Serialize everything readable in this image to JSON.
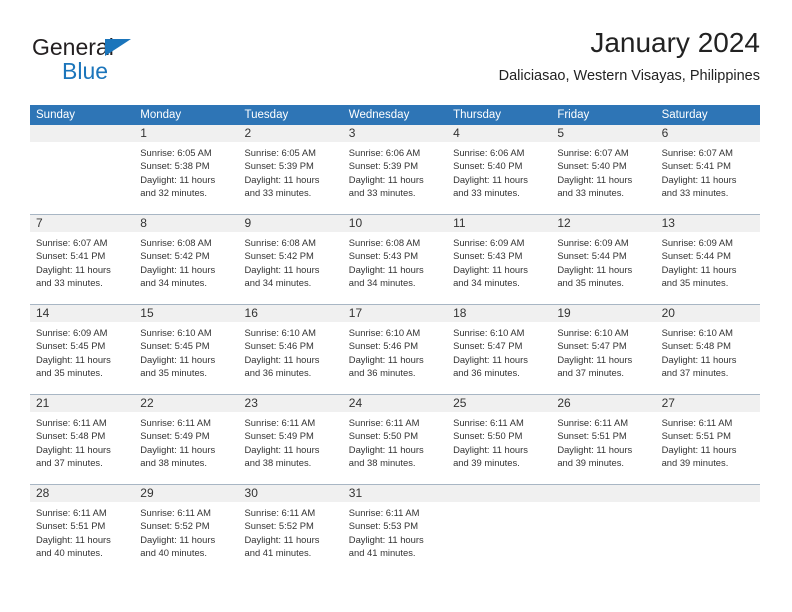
{
  "logo": {
    "word_one": "General",
    "word_two": "Blue",
    "triangle_color": "#1b75bb"
  },
  "header": {
    "title": "January 2024",
    "subtitle": "Daliciasao, Western Visayas, Philippines"
  },
  "colors": {
    "header_blue": "#2e75b6",
    "daynum_band": "#f0f0f0",
    "row_divider": "#a8b6c4",
    "text": "#333333"
  },
  "weekday_headers": [
    "Sunday",
    "Monday",
    "Tuesday",
    "Wednesday",
    "Thursday",
    "Friday",
    "Saturday"
  ],
  "weeks": [
    [
      {
        "day": "",
        "empty": true,
        "sunrise": "",
        "sunset": "",
        "daylight_a": "",
        "daylight_b": ""
      },
      {
        "day": "1",
        "sunrise": "Sunrise: 6:05 AM",
        "sunset": "Sunset: 5:38 PM",
        "daylight_a": "Daylight: 11 hours",
        "daylight_b": "and 32 minutes."
      },
      {
        "day": "2",
        "sunrise": "Sunrise: 6:05 AM",
        "sunset": "Sunset: 5:39 PM",
        "daylight_a": "Daylight: 11 hours",
        "daylight_b": "and 33 minutes."
      },
      {
        "day": "3",
        "sunrise": "Sunrise: 6:06 AM",
        "sunset": "Sunset: 5:39 PM",
        "daylight_a": "Daylight: 11 hours",
        "daylight_b": "and 33 minutes."
      },
      {
        "day": "4",
        "sunrise": "Sunrise: 6:06 AM",
        "sunset": "Sunset: 5:40 PM",
        "daylight_a": "Daylight: 11 hours",
        "daylight_b": "and 33 minutes."
      },
      {
        "day": "5",
        "sunrise": "Sunrise: 6:07 AM",
        "sunset": "Sunset: 5:40 PM",
        "daylight_a": "Daylight: 11 hours",
        "daylight_b": "and 33 minutes."
      },
      {
        "day": "6",
        "sunrise": "Sunrise: 6:07 AM",
        "sunset": "Sunset: 5:41 PM",
        "daylight_a": "Daylight: 11 hours",
        "daylight_b": "and 33 minutes."
      }
    ],
    [
      {
        "day": "7",
        "sunrise": "Sunrise: 6:07 AM",
        "sunset": "Sunset: 5:41 PM",
        "daylight_a": "Daylight: 11 hours",
        "daylight_b": "and 33 minutes."
      },
      {
        "day": "8",
        "sunrise": "Sunrise: 6:08 AM",
        "sunset": "Sunset: 5:42 PM",
        "daylight_a": "Daylight: 11 hours",
        "daylight_b": "and 34 minutes."
      },
      {
        "day": "9",
        "sunrise": "Sunrise: 6:08 AM",
        "sunset": "Sunset: 5:42 PM",
        "daylight_a": "Daylight: 11 hours",
        "daylight_b": "and 34 minutes."
      },
      {
        "day": "10",
        "sunrise": "Sunrise: 6:08 AM",
        "sunset": "Sunset: 5:43 PM",
        "daylight_a": "Daylight: 11 hours",
        "daylight_b": "and 34 minutes."
      },
      {
        "day": "11",
        "sunrise": "Sunrise: 6:09 AM",
        "sunset": "Sunset: 5:43 PM",
        "daylight_a": "Daylight: 11 hours",
        "daylight_b": "and 34 minutes."
      },
      {
        "day": "12",
        "sunrise": "Sunrise: 6:09 AM",
        "sunset": "Sunset: 5:44 PM",
        "daylight_a": "Daylight: 11 hours",
        "daylight_b": "and 35 minutes."
      },
      {
        "day": "13",
        "sunrise": "Sunrise: 6:09 AM",
        "sunset": "Sunset: 5:44 PM",
        "daylight_a": "Daylight: 11 hours",
        "daylight_b": "and 35 minutes."
      }
    ],
    [
      {
        "day": "14",
        "sunrise": "Sunrise: 6:09 AM",
        "sunset": "Sunset: 5:45 PM",
        "daylight_a": "Daylight: 11 hours",
        "daylight_b": "and 35 minutes."
      },
      {
        "day": "15",
        "sunrise": "Sunrise: 6:10 AM",
        "sunset": "Sunset: 5:45 PM",
        "daylight_a": "Daylight: 11 hours",
        "daylight_b": "and 35 minutes."
      },
      {
        "day": "16",
        "sunrise": "Sunrise: 6:10 AM",
        "sunset": "Sunset: 5:46 PM",
        "daylight_a": "Daylight: 11 hours",
        "daylight_b": "and 36 minutes."
      },
      {
        "day": "17",
        "sunrise": "Sunrise: 6:10 AM",
        "sunset": "Sunset: 5:46 PM",
        "daylight_a": "Daylight: 11 hours",
        "daylight_b": "and 36 minutes."
      },
      {
        "day": "18",
        "sunrise": "Sunrise: 6:10 AM",
        "sunset": "Sunset: 5:47 PM",
        "daylight_a": "Daylight: 11 hours",
        "daylight_b": "and 36 minutes."
      },
      {
        "day": "19",
        "sunrise": "Sunrise: 6:10 AM",
        "sunset": "Sunset: 5:47 PM",
        "daylight_a": "Daylight: 11 hours",
        "daylight_b": "and 37 minutes."
      },
      {
        "day": "20",
        "sunrise": "Sunrise: 6:10 AM",
        "sunset": "Sunset: 5:48 PM",
        "daylight_a": "Daylight: 11 hours",
        "daylight_b": "and 37 minutes."
      }
    ],
    [
      {
        "day": "21",
        "sunrise": "Sunrise: 6:11 AM",
        "sunset": "Sunset: 5:48 PM",
        "daylight_a": "Daylight: 11 hours",
        "daylight_b": "and 37 minutes."
      },
      {
        "day": "22",
        "sunrise": "Sunrise: 6:11 AM",
        "sunset": "Sunset: 5:49 PM",
        "daylight_a": "Daylight: 11 hours",
        "daylight_b": "and 38 minutes."
      },
      {
        "day": "23",
        "sunrise": "Sunrise: 6:11 AM",
        "sunset": "Sunset: 5:49 PM",
        "daylight_a": "Daylight: 11 hours",
        "daylight_b": "and 38 minutes."
      },
      {
        "day": "24",
        "sunrise": "Sunrise: 6:11 AM",
        "sunset": "Sunset: 5:50 PM",
        "daylight_a": "Daylight: 11 hours",
        "daylight_b": "and 38 minutes."
      },
      {
        "day": "25",
        "sunrise": "Sunrise: 6:11 AM",
        "sunset": "Sunset: 5:50 PM",
        "daylight_a": "Daylight: 11 hours",
        "daylight_b": "and 39 minutes."
      },
      {
        "day": "26",
        "sunrise": "Sunrise: 6:11 AM",
        "sunset": "Sunset: 5:51 PM",
        "daylight_a": "Daylight: 11 hours",
        "daylight_b": "and 39 minutes."
      },
      {
        "day": "27",
        "sunrise": "Sunrise: 6:11 AM",
        "sunset": "Sunset: 5:51 PM",
        "daylight_a": "Daylight: 11 hours",
        "daylight_b": "and 39 minutes."
      }
    ],
    [
      {
        "day": "28",
        "sunrise": "Sunrise: 6:11 AM",
        "sunset": "Sunset: 5:51 PM",
        "daylight_a": "Daylight: 11 hours",
        "daylight_b": "and 40 minutes."
      },
      {
        "day": "29",
        "sunrise": "Sunrise: 6:11 AM",
        "sunset": "Sunset: 5:52 PM",
        "daylight_a": "Daylight: 11 hours",
        "daylight_b": "and 40 minutes."
      },
      {
        "day": "30",
        "sunrise": "Sunrise: 6:11 AM",
        "sunset": "Sunset: 5:52 PM",
        "daylight_a": "Daylight: 11 hours",
        "daylight_b": "and 41 minutes."
      },
      {
        "day": "31",
        "sunrise": "Sunrise: 6:11 AM",
        "sunset": "Sunset: 5:53 PM",
        "daylight_a": "Daylight: 11 hours",
        "daylight_b": "and 41 minutes."
      },
      {
        "day": "",
        "empty": true,
        "sunrise": "",
        "sunset": "",
        "daylight_a": "",
        "daylight_b": ""
      },
      {
        "day": "",
        "empty": true,
        "sunrise": "",
        "sunset": "",
        "daylight_a": "",
        "daylight_b": ""
      },
      {
        "day": "",
        "empty": true,
        "sunrise": "",
        "sunset": "",
        "daylight_a": "",
        "daylight_b": ""
      }
    ]
  ]
}
